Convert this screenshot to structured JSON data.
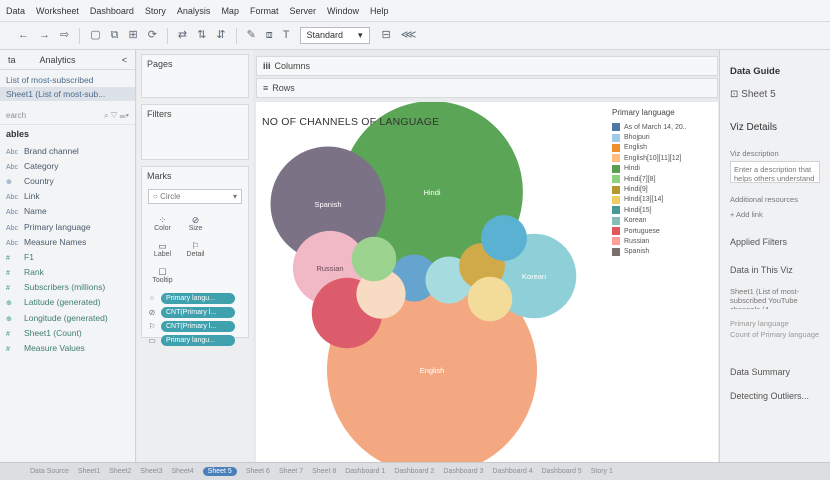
{
  "menu": [
    "Data",
    "Worksheet",
    "Dashboard",
    "Story",
    "Analysis",
    "Map",
    "Format",
    "Server",
    "Window",
    "Help"
  ],
  "toolbar": {
    "icons": [
      "back-icon",
      "forward-icon",
      "redo-icon",
      "save-icon",
      "new-datasource-icon",
      "new-worksheet-icon",
      "refresh-icon",
      "swap-icon",
      "sort-asc-icon",
      "sort-desc-icon",
      "highlight-icon",
      "group-icon",
      "label-icon",
      "present-icon",
      "share-icon"
    ],
    "fit": "Standard"
  },
  "datapane": {
    "tab_data": "ta",
    "tab_analytics": "Analytics",
    "collapse": "<",
    "datasources": [
      "List of most-subscribed",
      "Sheet1 (List of most-sub..."
    ],
    "search_placeholder": "earch",
    "tables_label": "ables",
    "fields": [
      {
        "type": "Abc",
        "name": "Brand channel"
      },
      {
        "type": "Abc",
        "name": "Category"
      },
      {
        "type": "⊕",
        "name": "Country"
      },
      {
        "type": "Abc",
        "name": "Link"
      },
      {
        "type": "Abc",
        "name": "Name"
      },
      {
        "type": "Abc",
        "name": "Primary language"
      },
      {
        "type": "Abc",
        "name": "Measure Names"
      },
      {
        "type": "#",
        "name": "F1",
        "meas": true
      },
      {
        "type": "#",
        "name": "Rank",
        "meas": true
      },
      {
        "type": "#",
        "name": "Subscribers (millions)",
        "meas": true
      },
      {
        "type": "⊕",
        "name": "Latitude (generated)",
        "meas": true
      },
      {
        "type": "⊕",
        "name": "Longitude (generated)",
        "meas": true
      },
      {
        "type": "#",
        "name": "Sheet1 (Count)",
        "meas": true
      },
      {
        "type": "#",
        "name": "Measure Values",
        "meas": true
      }
    ]
  },
  "cards": {
    "pages": "Pages",
    "filters": "Filters",
    "marks": "Marks",
    "mark_type": "Circle",
    "mark_buttons": [
      {
        "glyph": "⁘",
        "label": "Color",
        "name": "color-button"
      },
      {
        "glyph": "⊘",
        "label": "Size",
        "name": "size-button"
      },
      {
        "glyph": "▭",
        "label": "Label",
        "name": "label-button"
      },
      {
        "glyph": "⚐",
        "label": "Detail",
        "name": "detail-button"
      },
      {
        "glyph": "☐",
        "label": "Tooltip",
        "name": "tooltip-button"
      }
    ],
    "pills": [
      {
        "icon": "⁘",
        "label": "Primary langu..."
      },
      {
        "icon": "⊘",
        "label": "CNT(Primary l..."
      },
      {
        "icon": "⚐",
        "label": "CNT(Primary l..."
      },
      {
        "icon": "▭",
        "label": "Primary langu..."
      }
    ]
  },
  "shelves": {
    "columns": "Columns",
    "rows": "Rows",
    "columns_icon": "iii",
    "rows_icon": "≡"
  },
  "viz": {
    "title": "NO OF CHANNELS OF LANGUAGE",
    "legend_title": "Primary language",
    "legend": [
      {
        "label": "As of March 14, 20..",
        "color": "#4e79a7"
      },
      {
        "label": "Bhojpuri",
        "color": "#a0cbe8"
      },
      {
        "label": "English",
        "color": "#f28e2b"
      },
      {
        "label": "English[10][11][12]",
        "color": "#ffbe7d"
      },
      {
        "label": "Hindi",
        "color": "#59a14f"
      },
      {
        "label": "Hindi[7][8]",
        "color": "#8cd17d"
      },
      {
        "label": "Hindi[9]",
        "color": "#b6992d"
      },
      {
        "label": "Hindi[13][14]",
        "color": "#f1ce63"
      },
      {
        "label": "Hindi[15]",
        "color": "#499894"
      },
      {
        "label": "Korean",
        "color": "#86bcb6"
      },
      {
        "label": "Portuguese",
        "color": "#e15759"
      },
      {
        "label": "Russian",
        "color": "#ff9d9a"
      },
      {
        "label": "Spanish",
        "color": "#79706e"
      }
    ],
    "bubbles": [
      {
        "label": "English",
        "value": 40,
        "color": "#f4a882"
      },
      {
        "label": "Hindi",
        "value": 30,
        "color": "#5aa556"
      },
      {
        "label": "Spanish",
        "value": 12,
        "color": "#7c7285"
      },
      {
        "label": "Korean",
        "value": 6.5,
        "color": "#8fd0d8"
      },
      {
        "label": "Russian",
        "value": 5,
        "color": "#f1b9c6"
      },
      {
        "label": "",
        "value": 4.5,
        "color": "#dd5c6c"
      },
      {
        "label": "",
        "value": 2,
        "color": "#65a4cf"
      },
      {
        "label": "",
        "value": 2,
        "color": "#a6dce0"
      },
      {
        "label": "",
        "value": 2.2,
        "color": "#f7dbc2"
      },
      {
        "label": "",
        "value": 1.9,
        "color": "#d0a948"
      },
      {
        "label": "",
        "value": 1.8,
        "color": "#9cd38e"
      },
      {
        "label": "",
        "value": 1.8,
        "color": "#f3dc9a"
      },
      {
        "label": "",
        "value": 1.9,
        "color": "#5bb1d2"
      }
    ]
  },
  "guide": {
    "title": "Data Guide",
    "sheet": "Sheet 5",
    "viz_details": "Viz Details",
    "viz_desc_label": "Viz description",
    "viz_desc_placeholder": "Enter a description that helps others understand this viz",
    "add_resources": "Additional resources",
    "add_link": "+ Add link",
    "applied_filters": "Applied Filters",
    "data_in_viz": "Data in This Viz",
    "source_item": "Sheet1 (List of most-subscribed YouTube channels (4",
    "sub1": "Primary language",
    "sub2": "Count of Primary language",
    "data_summary": "Data Summary",
    "detecting_outliers": "Detecting Outliers..."
  },
  "sheets": [
    {
      "label": "Data Source"
    },
    {
      "label": "Sheet1"
    },
    {
      "label": "Sheet2"
    },
    {
      "label": "Sheet3"
    },
    {
      "label": "Sheet4"
    },
    {
      "label": "Sheet 5",
      "active": true
    },
    {
      "label": "Sheet 6"
    },
    {
      "label": "Sheet 7"
    },
    {
      "label": "Sheet 8"
    },
    {
      "label": "Dashboard 1"
    },
    {
      "label": "Dashboard 2"
    },
    {
      "label": "Dashboard 3"
    },
    {
      "label": "Dashboard 4"
    },
    {
      "label": "Dashboard 5"
    },
    {
      "label": "Story 1"
    }
  ]
}
